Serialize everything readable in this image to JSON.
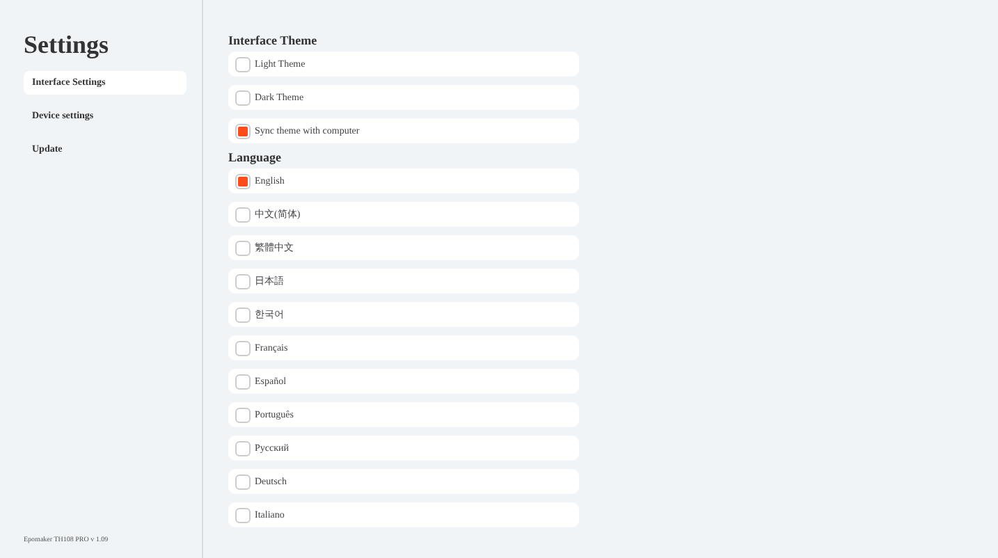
{
  "sidebar": {
    "title": "Settings",
    "items": [
      {
        "label": "Interface Settings",
        "selected": true
      },
      {
        "label": "Device settings",
        "selected": false
      },
      {
        "label": "Update",
        "selected": false
      }
    ],
    "footer": "Epomaker TH108 PRO v 1.09"
  },
  "sections": [
    {
      "heading": "Interface Theme",
      "options": [
        {
          "label": "Light Theme",
          "checked": false
        },
        {
          "label": "Dark Theme",
          "checked": false
        },
        {
          "label": "Sync theme with computer",
          "checked": true
        }
      ]
    },
    {
      "heading": "Language",
      "options": [
        {
          "label": "English",
          "checked": true
        },
        {
          "label": "中文(简体)",
          "checked": false
        },
        {
          "label": "繁體中文",
          "checked": false
        },
        {
          "label": "日本語",
          "checked": false
        },
        {
          "label": "한국어",
          "checked": false
        },
        {
          "label": "Français",
          "checked": false
        },
        {
          "label": "Español",
          "checked": false
        },
        {
          "label": "Português",
          "checked": false
        },
        {
          "label": "Русский",
          "checked": false
        },
        {
          "label": "Deutsch",
          "checked": false
        },
        {
          "label": "Italiano",
          "checked": false
        }
      ]
    }
  ]
}
